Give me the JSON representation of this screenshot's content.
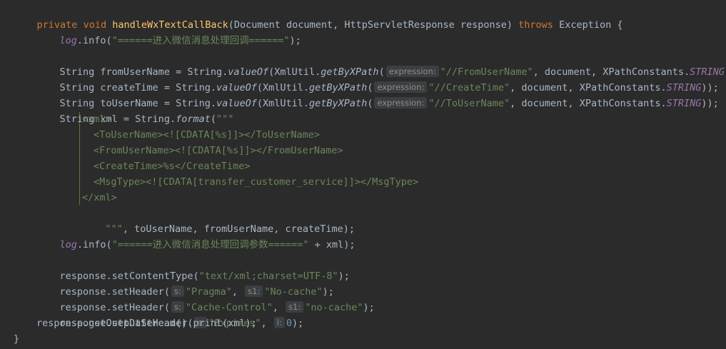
{
  "code": {
    "l1": {
      "kw_private": "private",
      "kw_void": "void",
      "method": "handleWxTextCallBack",
      "params": "(Document document, HttpServletResponse response) ",
      "kw_throws": "throws",
      "rest": " Exception {"
    },
    "l2": {
      "field": "log",
      "call": ".info(",
      "str": "\"======进入微信消息处理回调======\"",
      "end": ");"
    },
    "l3": {
      "a": "String fromUserName = String.",
      "m1": "valueOf",
      "b": "(XmlUtil.",
      "m2": "getByXPath",
      "c": "(",
      "hint": "expression:",
      "str": "\"//FromUserName\"",
      "d": ", document, XPathConstants.",
      "const": "STRING",
      "e": "));"
    },
    "l4": {
      "a": "String createTime = String.",
      "m1": "valueOf",
      "b": "(XmlUtil.",
      "m2": "getByXPath",
      "c": "(",
      "hint": "expression:",
      "str": "\"//CreateTime\"",
      "d": ", document, XPathConstants.",
      "const": "STRING",
      "e": "));"
    },
    "l5": {
      "a": "String toUserName = String.",
      "m1": "valueOf",
      "b": "(XmlUtil.",
      "m2": "getByXPath",
      "c": "(",
      "hint": "expression:",
      "str": "\"//ToUserName\"",
      "d": ", document, XPathConstants.",
      "const": "STRING",
      "e": "));"
    },
    "l6": {
      "a": "String xml = String.",
      "m": "format",
      "b": "(",
      "str": "\"\"\""
    },
    "l7": "<xml>",
    "l8": "<ToUserName><![CDATA[%s]]></ToUserName>",
    "l9": "<FromUserName><![CDATA[%s]]></FromUserName>",
    "l10": "<CreateTime>%s</CreateTime>",
    "l11": "<MsgType><![CDATA[transfer_customer_service]]></MsgType>",
    "l12": "</xml>",
    "l13": {
      "str": "\"\"\"",
      "rest": ", toUserName, fromUserName, createTime);"
    },
    "l14": {
      "field": "log",
      "call": ".info(",
      "str": "\"======进入微信消息处理回调参数======\"",
      "end": " + xml);"
    },
    "l15": {
      "a": "response.setContentType(",
      "str": "\"text/xml;charset=UTF-8\"",
      "end": ");"
    },
    "l16": {
      "a": "response.setHeader(",
      "h1": "s:",
      "s1": "\"Pragma\"",
      "sep": ", ",
      "h2": "s1:",
      "s2": "\"No-cache\"",
      "end": ");"
    },
    "l17": {
      "a": "response.setHeader(",
      "h1": "s:",
      "s1": "\"Cache-Control\"",
      "sep": ", ",
      "h2": "s1:",
      "s2": "\"no-cache\"",
      "end": ");"
    },
    "l18": {
      "a": "response.setDateHeader(",
      "h1": "s:",
      "s1": "\"Expires\"",
      "sep": ", ",
      "h2": "l:",
      "num": "0",
      "end": ");"
    },
    "l19": "response.getOutputStream().print(xml);",
    "l20": "}"
  }
}
